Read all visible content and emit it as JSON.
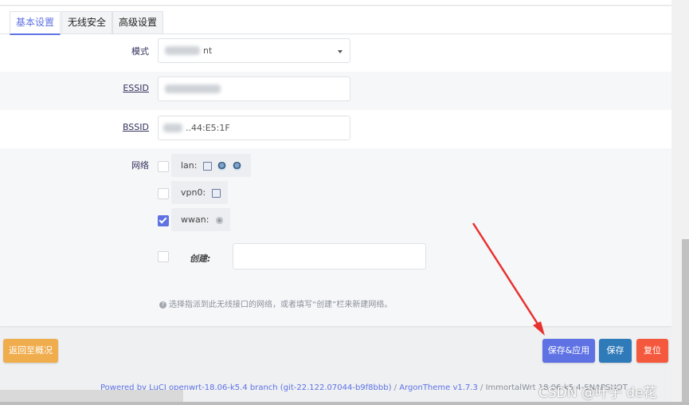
{
  "tabs": [
    {
      "label": "基本设置",
      "active": true
    },
    {
      "label": "无线安全",
      "active": false
    },
    {
      "label": "高级设置",
      "active": false
    }
  ],
  "fields": {
    "mode": {
      "label": "模式",
      "value_visible": "nt"
    },
    "essid": {
      "label": "ESSID"
    },
    "bssid": {
      "label": "BSSID",
      "value_visible": "..44:E5:1F"
    }
  },
  "network": {
    "label": "网络",
    "items": [
      {
        "label": "lan:",
        "checked": false,
        "icons": [
          "computer-icon",
          "network-icon",
          "network-icon"
        ]
      },
      {
        "label": "vpn0:",
        "checked": false,
        "icons": [
          "computer-icon"
        ]
      },
      {
        "label": "wwan:",
        "checked": true,
        "icons": [
          "wireless-icon"
        ]
      }
    ],
    "create_label": "创建:",
    "help": "选择指派到此无线接口的网络，或者填写“创建”栏来新建网络。"
  },
  "buttons": {
    "back": "返回至概况",
    "save_apply": "保存&应用",
    "save": "保存",
    "reset": "复位"
  },
  "colors": {
    "accent": "#5e72e4",
    "back_btn": "#f0ad4e",
    "save_btn": "#2f7ab8",
    "reset_btn": "#f5593d",
    "arrow": "#e8322f"
  },
  "footer": {
    "powered": "Powered by LuCI openwrt-18.06-k5.4 branch (git-22.122.07044-b9f8bbb)",
    "sep1": " / ",
    "theme": "ArgonTheme v1.7.3",
    "sep2": " / ",
    "firmware": "ImmortalWrt 18.06-k5.4-SNAPSHOT"
  },
  "watermark": "CSDN @叶子 de花"
}
